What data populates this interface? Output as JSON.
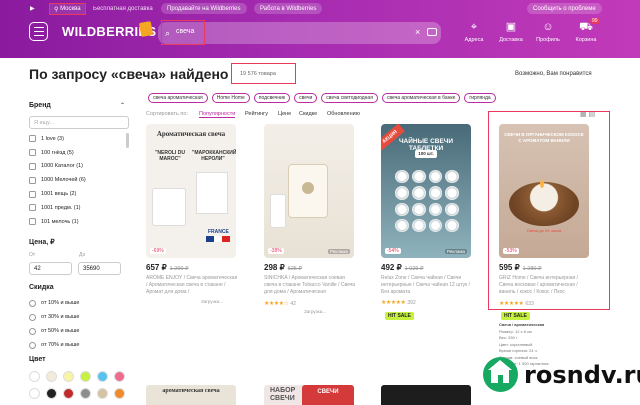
{
  "header": {
    "city": "Москва",
    "free_delivery": "Бесплатная доставка",
    "sell": "Продавайте на Wildberries",
    "work": "Работа в Wildberries",
    "help": "Сообщить о проблеме",
    "logo": "WILDBERRIES",
    "search_value": "свеча",
    "nav": [
      {
        "label": "Адреса",
        "icon": "map-pin-icon"
      },
      {
        "label": "Доставка",
        "icon": "truck-icon"
      },
      {
        "label": "Профиль",
        "icon": "user-icon"
      },
      {
        "label": "Корзина",
        "icon": "cart-icon",
        "badge": "99"
      }
    ]
  },
  "page": {
    "title": "По запросу «свеча» найдено",
    "count": "19 576 товара",
    "maybe": "Возможно, Вам понравится",
    "chips": [
      "свеча ароматическая",
      "Home Home",
      "подсвечник",
      "свечи",
      "свеча светодиодная",
      "свеча ароматическая в банке",
      "гирлянда"
    ],
    "sort_label": "Сортировать по:",
    "sort": [
      "Популярности",
      "Рейтингу",
      "Цене",
      "Скидке",
      "Обновлению"
    ]
  },
  "filters": {
    "brand_title": "Бренд",
    "brand_search": "Я ищу...",
    "brands": [
      "1 love (3)",
      "100 гнёзд (5)",
      "1000 Каталог (1)",
      "1000 Мелочей (6)",
      "1001 вещь (2)",
      "1001 предм. (1)",
      "101 мелочь (1)"
    ],
    "price_title": "Цена, ₽",
    "price_from_label": "От",
    "price_to_label": "До",
    "price_from": "42",
    "price_to": "35690",
    "discount_title": "Скидка",
    "discounts": [
      "от 10% и выше",
      "от 30% и выше",
      "от 50% и выше",
      "от 70% и выше"
    ],
    "color_title": "Цвет",
    "swatches": [
      "#ffffff",
      "#f3eadb",
      "#f7f3a7",
      "#c6f13f",
      "#55c2f0",
      "#f06a8f",
      "#ffffff",
      "#222222",
      "#c22b2b",
      "#8d8d8d",
      "#d6c3a4",
      "#f08a2c"
    ]
  },
  "products": [
    {
      "img_title": "Ароматическая свеча",
      "img_sub": "\"NEROLI DU MAROC\"",
      "img_sub2": "\"МАРОККАНСКИЙ НЕРОЛИ\"",
      "france": "FRANCE",
      "disc": "-69%",
      "price": "657 ₽",
      "old": "1 290 ₽",
      "name": "AROME ENJOY / Свеча ароматическая / Ароматическая свеча в стакане / Аромат для дома /",
      "stars": "",
      "reviews": "",
      "sub": "Загрузка...",
      "adv": ""
    },
    {
      "disc": "-38%",
      "price": "298 ₽",
      "old": "625 ₽",
      "name": "SINICHKA / Ароматическая соевая свеча в стакане Tobacco Vanille / Свеча для дома / Ароматическая",
      "stars": "★★★★☆",
      "reviews": "42",
      "sub": "Загрузка...",
      "adv": "Реклама"
    },
    {
      "img_label": "АКЦИЯ",
      "img_title": "ЧАЙНЫЕ СВЕЧИ ТАБЛЕТКИ",
      "img_sub": "100 шт.",
      "disc": "-54%",
      "price": "492 ₽",
      "old": "1 029 ₽",
      "name": "Relax Zone / Свеча чайная / Свечи интерьерные / Свеча чайная 12 штук / Без аромата",
      "stars": "★★★★★",
      "reviews": "392",
      "sub": "",
      "hit": "HIT SALE",
      "adv": "Реклама"
    },
    {
      "img_title": "СВЕЧИ В ОРГАНИЧЕСКОМ КОКОСЕ С АРОМАТОМ ВАНИЛИ",
      "img_note": "Свеча до 24 часов",
      "disc": "-53%",
      "price": "595 ₽",
      "old": "1 280 ₽",
      "name": "GRIZ Home / Свеча интерьерная / Свеча восковая / ароматическая / ваниль / кокос / Кокос / Пкос",
      "stars": "★★★★★",
      "reviews": "633",
      "sub": "",
      "hit": "HIT SALE",
      "adv": ""
    }
  ],
  "specs": {
    "header": "Свеча / ароматическая",
    "lines": [
      "Размер: 12 х 8 см",
      "Вес: 250 г",
      "Цвет: коричневый",
      "Время горения: 24 ч",
      "Состав: соевый воск",
      "Растение: 1 500 гаргантюа"
    ]
  },
  "bottom_cards": [
    {
      "text": "ароматическая свеча"
    },
    {
      "text": "НАБОР СВЕЧИ"
    },
    {
      "text": "СВЕЧИ"
    }
  ],
  "watermark": {
    "text": "rosndv.ru"
  }
}
